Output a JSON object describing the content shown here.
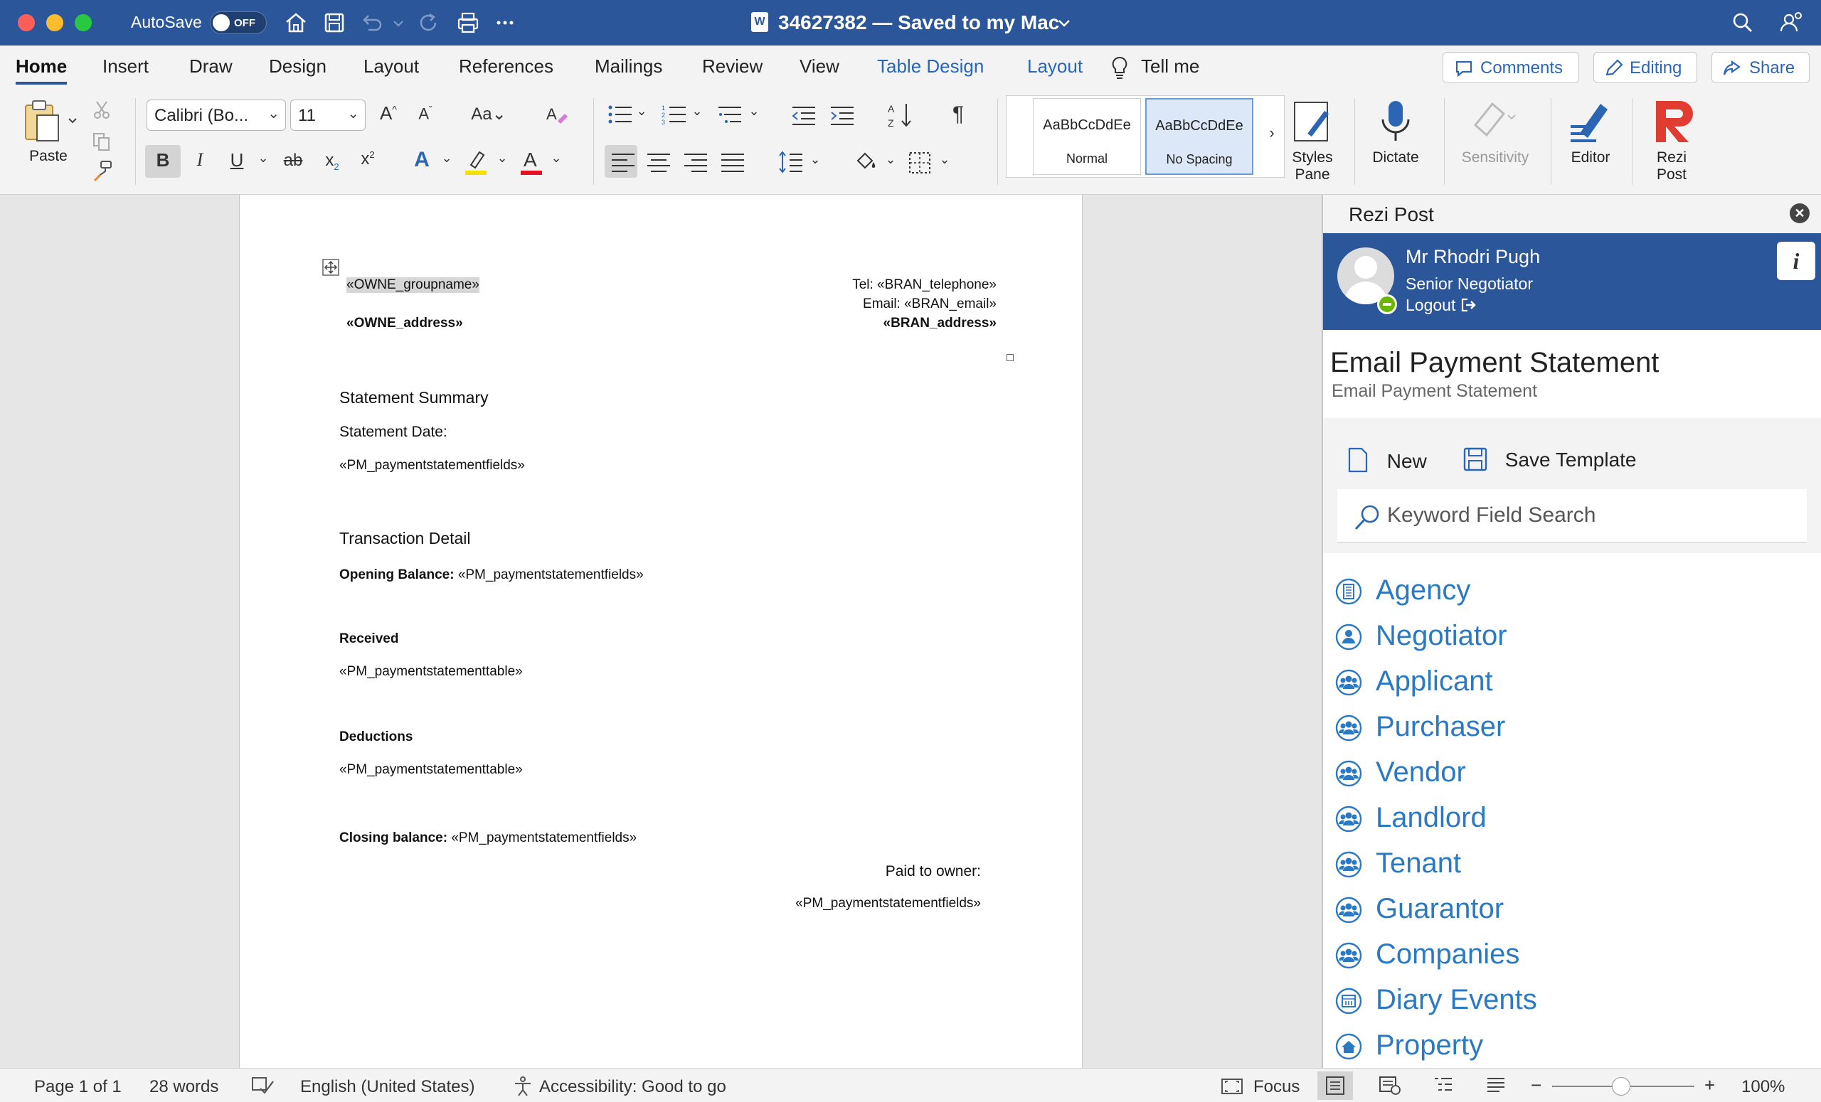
{
  "titlebar": {
    "autosave_label": "AutoSave",
    "autosave_state": "OFF",
    "document_title": "34627382 — Saved to my Mac"
  },
  "tabs": [
    {
      "label": "Home"
    },
    {
      "label": "Insert"
    },
    {
      "label": "Draw"
    },
    {
      "label": "Design"
    },
    {
      "label": "Layout"
    },
    {
      "label": "References"
    },
    {
      "label": "Mailings"
    },
    {
      "label": "Review"
    },
    {
      "label": "View"
    },
    {
      "label": "Table Design"
    },
    {
      "label": "Layout"
    }
  ],
  "tell_me": "Tell me",
  "ribbon_actions": {
    "comments": "Comments",
    "editing": "Editing",
    "share": "Share"
  },
  "ribbon": {
    "paste_label": "Paste",
    "font_name": "Calibri (Bo...",
    "font_size": "11",
    "styles": [
      {
        "sample": "AaBbCcDdEe",
        "name": "Normal"
      },
      {
        "sample": "AaBbCcDdEe",
        "name": "No Spacing"
      }
    ],
    "styles_pane": "Styles Pane",
    "dictate": "Dictate",
    "sensitivity": "Sensitivity",
    "editor": "Editor",
    "rezi_post": "Rezi Post"
  },
  "document": {
    "owner_groupname": "«OWNE_groupname»",
    "owner_address": "«OWNE_address»",
    "tel": "Tel: «BRAN_telephone»",
    "email": "Email: «BRAN_email»",
    "bran_address": "«BRAN_address»",
    "summary_heading": "Statement Summary",
    "statement_date": "Statement Date:",
    "summary_fields": "«PM_paymentstatementfields»",
    "transaction_heading": "Transaction Detail",
    "opening_label": "Opening Balance:",
    "opening_value": "«PM_paymentstatementfields»",
    "received_label": "Received",
    "received_table": "«PM_paymentstatementtable»",
    "deductions_label": "Deductions",
    "deductions_table": "«PM_paymentstatementtable»",
    "closing_label": "Closing balance:",
    "closing_value": "«PM_paymentstatementfields»",
    "paid_to_owner": "Paid to owner:",
    "paid_fields": "«PM_paymentstatementfields»"
  },
  "pane": {
    "title": "Rezi Post",
    "user_name": "Mr Rhodri Pugh",
    "user_role": "Senior Negotiator",
    "logout": "Logout",
    "section_title": "Email Payment Statement",
    "section_subtitle": "Email Payment Statement",
    "new_label": "New",
    "save_template_label": "Save Template",
    "search_placeholder": "Keyword Field Search",
    "categories": [
      {
        "label": "Agency",
        "icon": "building-icon"
      },
      {
        "label": "Negotiator",
        "icon": "person-icon"
      },
      {
        "label": "Applicant",
        "icon": "people-icon"
      },
      {
        "label": "Purchaser",
        "icon": "people-icon"
      },
      {
        "label": "Vendor",
        "icon": "people-icon"
      },
      {
        "label": "Landlord",
        "icon": "people-icon"
      },
      {
        "label": "Tenant",
        "icon": "people-icon"
      },
      {
        "label": "Guarantor",
        "icon": "people-icon"
      },
      {
        "label": "Companies",
        "icon": "people-icon"
      },
      {
        "label": "Diary Events",
        "icon": "calendar-icon"
      },
      {
        "label": "Property",
        "icon": "home-icon"
      }
    ]
  },
  "status": {
    "page": "Page 1 of 1",
    "words": "28 words",
    "language": "English (United States)",
    "accessibility": "Accessibility: Good to go",
    "focus": "Focus",
    "zoom": "100%",
    "zoom_level_percent": 100
  },
  "colors": {
    "titlebar": "#2b579a",
    "link_blue": "#2b79c2",
    "presence": "#6bb700",
    "rezi_red": "#e03c31"
  }
}
